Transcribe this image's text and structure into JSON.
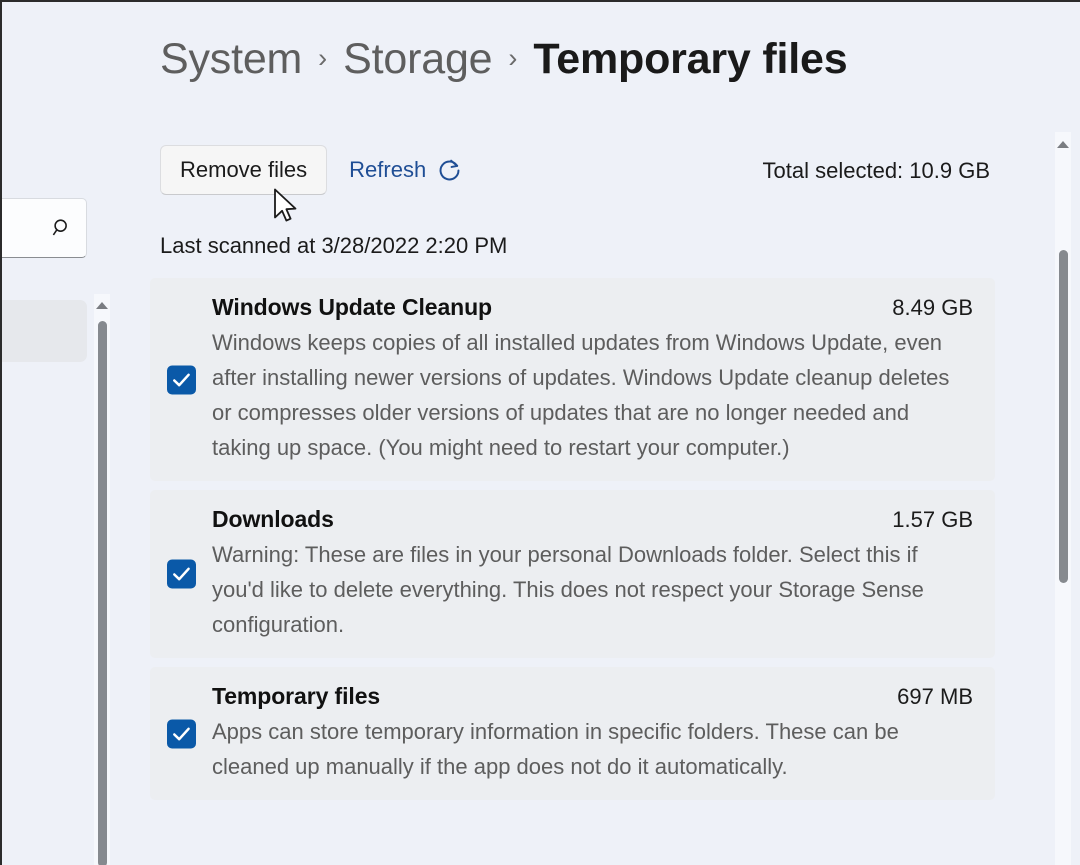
{
  "breadcrumb": {
    "items": [
      {
        "label": "System",
        "current": false
      },
      {
        "label": "Storage",
        "current": false
      },
      {
        "label": "Temporary files",
        "current": true
      }
    ],
    "separator": "›"
  },
  "nav": {
    "search_placeholder": "",
    "search_value": "",
    "search_icon": "search-icon"
  },
  "toolbar": {
    "remove_files_label": "Remove files",
    "refresh_label": "Refresh",
    "refresh_icon": "refresh-icon",
    "total_selected_label": "Total selected: 10.9 GB",
    "last_scanned_label": "Last scanned at 3/28/2022 2:20 PM"
  },
  "files": [
    {
      "title": "Windows Update Cleanup",
      "size": "8.49 GB",
      "description": "Windows keeps copies of all installed updates from Windows Update, even after installing newer versions of updates. Windows Update cleanup deletes or compresses older versions of updates that are no longer needed and taking up space. (You might need to restart your computer.)",
      "checked": true
    },
    {
      "title": "Downloads",
      "size": "1.57 GB",
      "description": "Warning: These are files in your personal Downloads folder. Select this if you'd like to delete everything. This does not respect your Storage Sense configuration.",
      "checked": true
    },
    {
      "title": "Temporary files",
      "size": "697 MB",
      "description": "Apps can store temporary information in specific folders. These can be cleaned up manually if the app does not do it automatically.",
      "checked": true
    }
  ],
  "colors": {
    "page_background": "#eef1f8",
    "card_background": "#eceef1",
    "accent_blue": "#0a59a8",
    "link_blue": "#1f4e95",
    "title_text": "#111111",
    "body_text": "#5d5d5d"
  }
}
